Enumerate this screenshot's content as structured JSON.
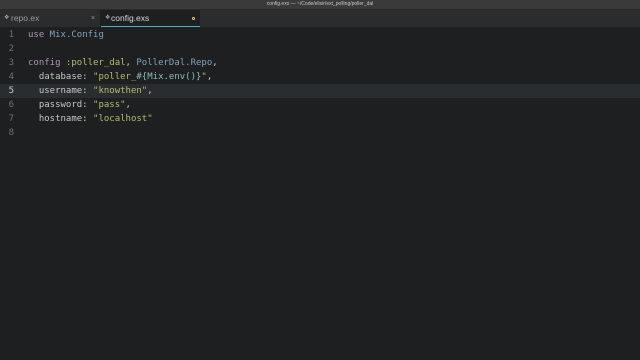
{
  "window": {
    "title": "config.exs — ~/Code/elixir/ext_polling/poller_dal"
  },
  "tabs": [
    {
      "label": "repo.ex",
      "active": false,
      "close_glyph": "×"
    },
    {
      "label": "config.exs",
      "active": true
    }
  ],
  "editor": {
    "current_line": 5,
    "lines": [
      {
        "num": "1",
        "tokens": [
          {
            "t": "use",
            "c": "kw"
          },
          {
            "t": " Mix.Config",
            "c": "mod"
          }
        ]
      },
      {
        "num": "2",
        "tokens": []
      },
      {
        "num": "3",
        "tokens": [
          {
            "t": "config",
            "c": "kw"
          },
          {
            "t": " :poller_dal",
            "c": "atom"
          },
          {
            "t": ", ",
            "c": "punct"
          },
          {
            "t": "PollerDal.Repo",
            "c": "mod"
          },
          {
            "t": ",",
            "c": "punct"
          }
        ]
      },
      {
        "num": "4",
        "tokens": [
          {
            "t": "  database: ",
            "c": "key"
          },
          {
            "t": "\"poller_",
            "c": "str"
          },
          {
            "t": "#{Mix.env()}",
            "c": "interp"
          },
          {
            "t": "\"",
            "c": "str"
          },
          {
            "t": ",",
            "c": "punct"
          }
        ]
      },
      {
        "num": "5",
        "tokens": [
          {
            "t": "  username: ",
            "c": "key"
          },
          {
            "t": "\"knowthen\"",
            "c": "str"
          },
          {
            "t": ",",
            "c": "punct"
          }
        ]
      },
      {
        "num": "6",
        "tokens": [
          {
            "t": "  password: ",
            "c": "key"
          },
          {
            "t": "\"pass\"",
            "c": "str"
          },
          {
            "t": ",",
            "c": "punct"
          }
        ]
      },
      {
        "num": "7",
        "tokens": [
          {
            "t": "  hostname: ",
            "c": "key"
          },
          {
            "t": "\"localhost\"",
            "c": "str"
          }
        ]
      },
      {
        "num": "8",
        "tokens": []
      }
    ]
  }
}
